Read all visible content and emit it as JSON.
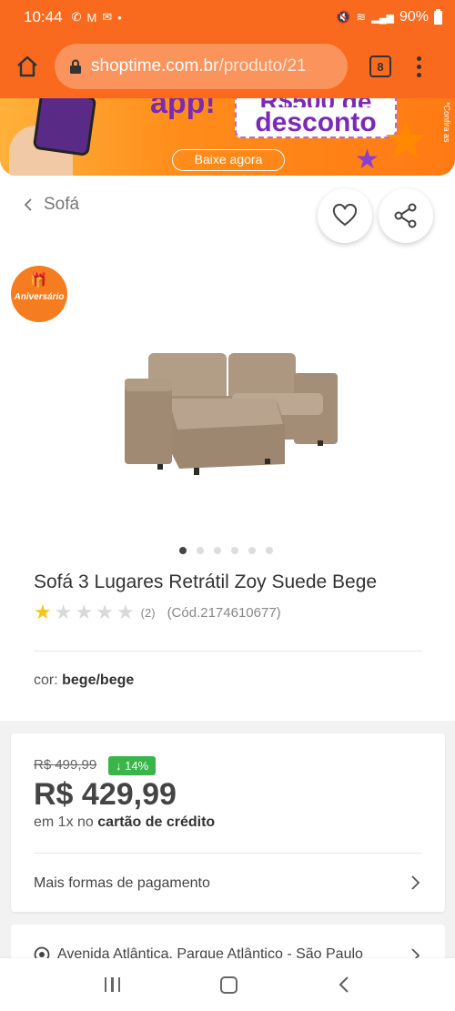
{
  "status_bar": {
    "time": "10:44",
    "left_icons": [
      "whatsapp-icon",
      "gmail-icon",
      "mail-icon",
      "dot-icon"
    ],
    "battery": "90%"
  },
  "browser": {
    "url_domain": "shoptime.com.br",
    "url_path": "/produto/21",
    "tab_count": "8"
  },
  "banner": {
    "app_text": "app!",
    "promo_top": "R$500 de",
    "promo_main": "desconto",
    "cta": "Baixe agora",
    "side_note": "*Confira as"
  },
  "breadcrumb": {
    "label": "Sofá"
  },
  "badge": {
    "label": "Aniversário"
  },
  "product": {
    "title": "Sofá 3 Lugares Retrátil Zoy Suede Bege",
    "rating": 1,
    "rating_max": 5,
    "review_count": "(2)",
    "code": "(Cód.2174610677)",
    "color_label": "cor:",
    "color_value": "bege/bege",
    "image_count": 6,
    "active_image": 0
  },
  "price": {
    "old": "R$ 499,99",
    "discount": "↓ 14%",
    "current": "R$ 429,99",
    "installments_prefix": "em 1x no",
    "installments_bold": "cartão de crédito",
    "more_payment": "Mais formas de pagamento"
  },
  "address": {
    "text": "Avenida Atlântica, Parque Atlântico - São Paulo"
  },
  "colors": {
    "brand_orange": "#f96a1e",
    "discount_green": "#3ab54a",
    "star_yellow": "#f5c518"
  }
}
